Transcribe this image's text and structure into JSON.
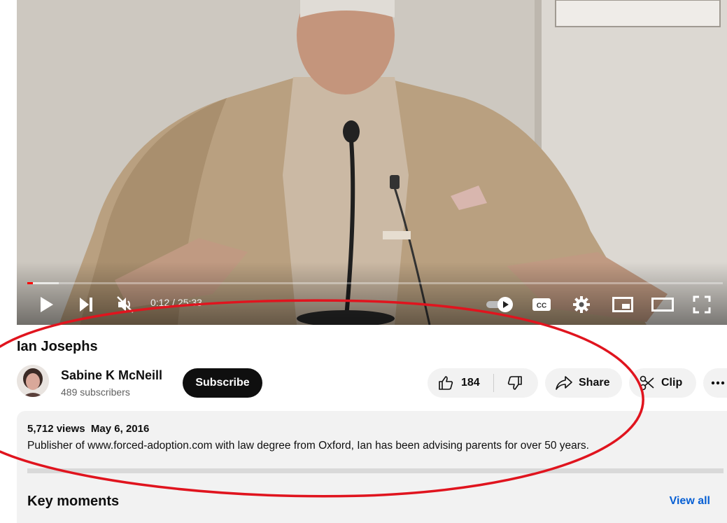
{
  "player": {
    "current_time": "0:12",
    "separator": " / ",
    "duration": "25:33",
    "progress_fraction": 0.0078,
    "buffered_fraction": 0.045,
    "progress_color": "#ff0000",
    "icons": [
      "play-icon",
      "next-icon",
      "volume-muted-icon",
      "autoplay-toggle-icon",
      "captions-icon",
      "settings-icon",
      "miniplayer-icon",
      "theater-mode-icon",
      "fullscreen-icon"
    ]
  },
  "video": {
    "title": "Ian Josephs"
  },
  "channel": {
    "name": "Sabine K McNeill",
    "subscribers": "489 subscribers",
    "subscribe_label": "Subscribe"
  },
  "actions": {
    "like_count": "184",
    "share_label": "Share",
    "clip_label": "Clip"
  },
  "description": {
    "views": "5,712 views",
    "date": "May 6, 2016",
    "text": "Publisher of www.forced-adoption.com with law degree from Oxford, Ian has been advising parents for over 50 years."
  },
  "key_moments": {
    "heading": "Key moments",
    "view_all_label": "View all"
  },
  "annotation_color": "#e0141e"
}
